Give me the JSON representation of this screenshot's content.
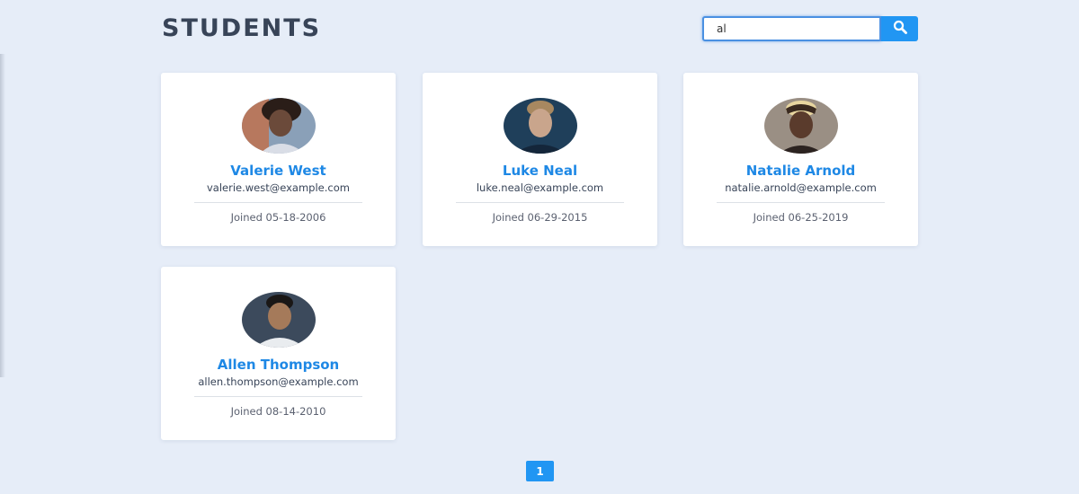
{
  "header": {
    "title": "STUDENTS"
  },
  "search": {
    "value": "al",
    "icon": "magnifier-icon"
  },
  "students": [
    {
      "name": "Valerie West",
      "email": "valerie.west@example.com",
      "joined": "Joined 05-18-2006",
      "avatar_tone": "#6b4a3a"
    },
    {
      "name": "Luke Neal",
      "email": "luke.neal@example.com",
      "joined": "Joined 06-29-2015",
      "avatar_tone": "#c9a58c"
    },
    {
      "name": "Natalie Arnold",
      "email": "natalie.arnold@example.com",
      "joined": "Joined 06-25-2019",
      "avatar_tone": "#5a3b2c"
    },
    {
      "name": "Allen Thompson",
      "email": "allen.thompson@example.com",
      "joined": "Joined 08-14-2010",
      "avatar_tone": "#a57a5a"
    }
  ],
  "pagination": {
    "current": "1"
  },
  "colors": {
    "accent": "#2196f3",
    "name": "#1e88e5",
    "title": "#384458",
    "background": "#e6edf8"
  }
}
